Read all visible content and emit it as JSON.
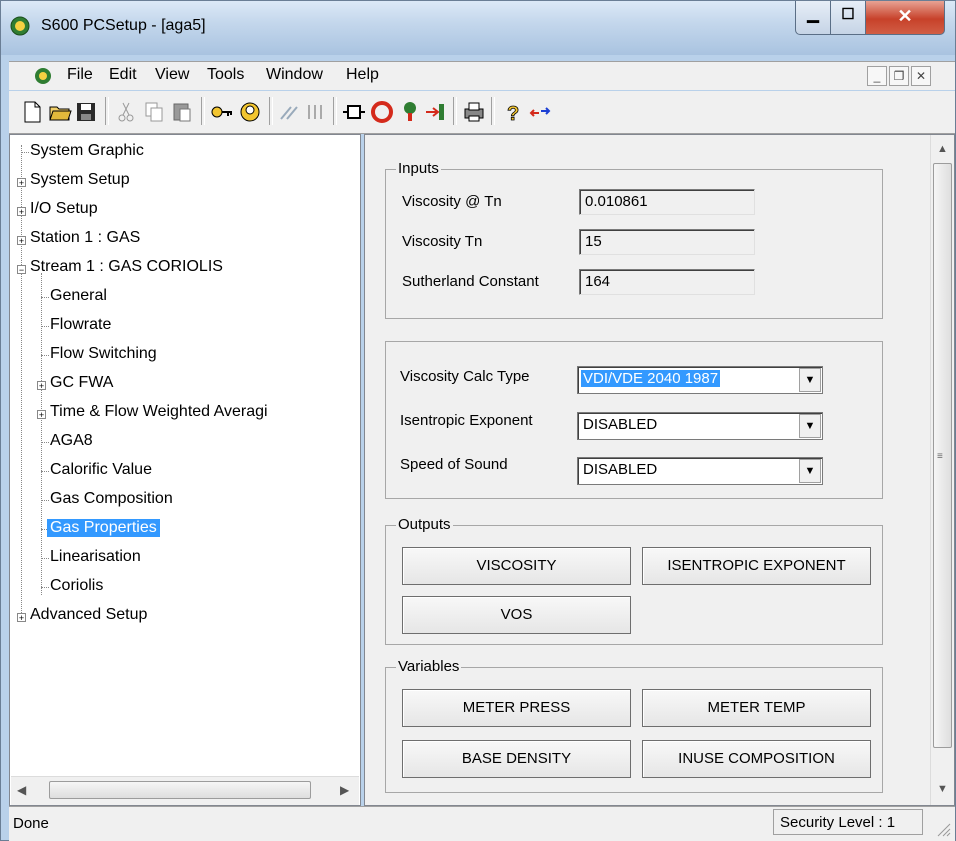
{
  "window": {
    "title": "S600 PCSetup - [aga5]"
  },
  "menubar": {
    "items": [
      "File",
      "Edit",
      "View",
      "Tools",
      "Window",
      "Help"
    ]
  },
  "tree": {
    "items": [
      {
        "label": "System Graphic"
      },
      {
        "label": "System Setup"
      },
      {
        "label": "I/O Setup"
      },
      {
        "label": "Station 1 : GAS"
      },
      {
        "label": "Stream 1 : GAS CORIOLIS"
      },
      {
        "label": "General"
      },
      {
        "label": "Flowrate"
      },
      {
        "label": "Flow Switching"
      },
      {
        "label": "GC FWA"
      },
      {
        "label": "Time & Flow Weighted Averagi"
      },
      {
        "label": "AGA8"
      },
      {
        "label": "Calorific Value"
      },
      {
        "label": "Gas Composition"
      },
      {
        "label": "Gas Properties"
      },
      {
        "label": "Linearisation"
      },
      {
        "label": "Coriolis"
      },
      {
        "label": "Advanced Setup"
      }
    ]
  },
  "inputs": {
    "title": "Inputs",
    "viscosity_tn_at_label": "Viscosity @ Tn",
    "viscosity_tn_at_value": "0.010861",
    "viscosity_tn_label": "Viscosity Tn",
    "viscosity_tn_value": "15",
    "sutherland_label": "Sutherland Constant",
    "sutherland_value": "164"
  },
  "settings": {
    "calc_type_label": "Viscosity Calc Type",
    "calc_type_value": "VDI/VDE 2040 1987",
    "isentropic_label": "Isentropic Exponent",
    "isentropic_value": "DISABLED",
    "sound_label": "Speed of Sound",
    "sound_value": "DISABLED"
  },
  "outputs": {
    "title": "Outputs",
    "viscosity": "VISCOSITY",
    "isentropic": "ISENTROPIC EXPONENT",
    "vos": "VOS"
  },
  "variables": {
    "title": "Variables",
    "meter_press": "METER PRESS",
    "meter_temp": "METER TEMP",
    "base_density": "BASE DENSITY",
    "inuse_composition": "INUSE COMPOSITION"
  },
  "statusbar": {
    "left": "Done",
    "right": "Security Level : 1"
  },
  "colors": {
    "selection": "#3399ff",
    "close": "#c7412a"
  }
}
